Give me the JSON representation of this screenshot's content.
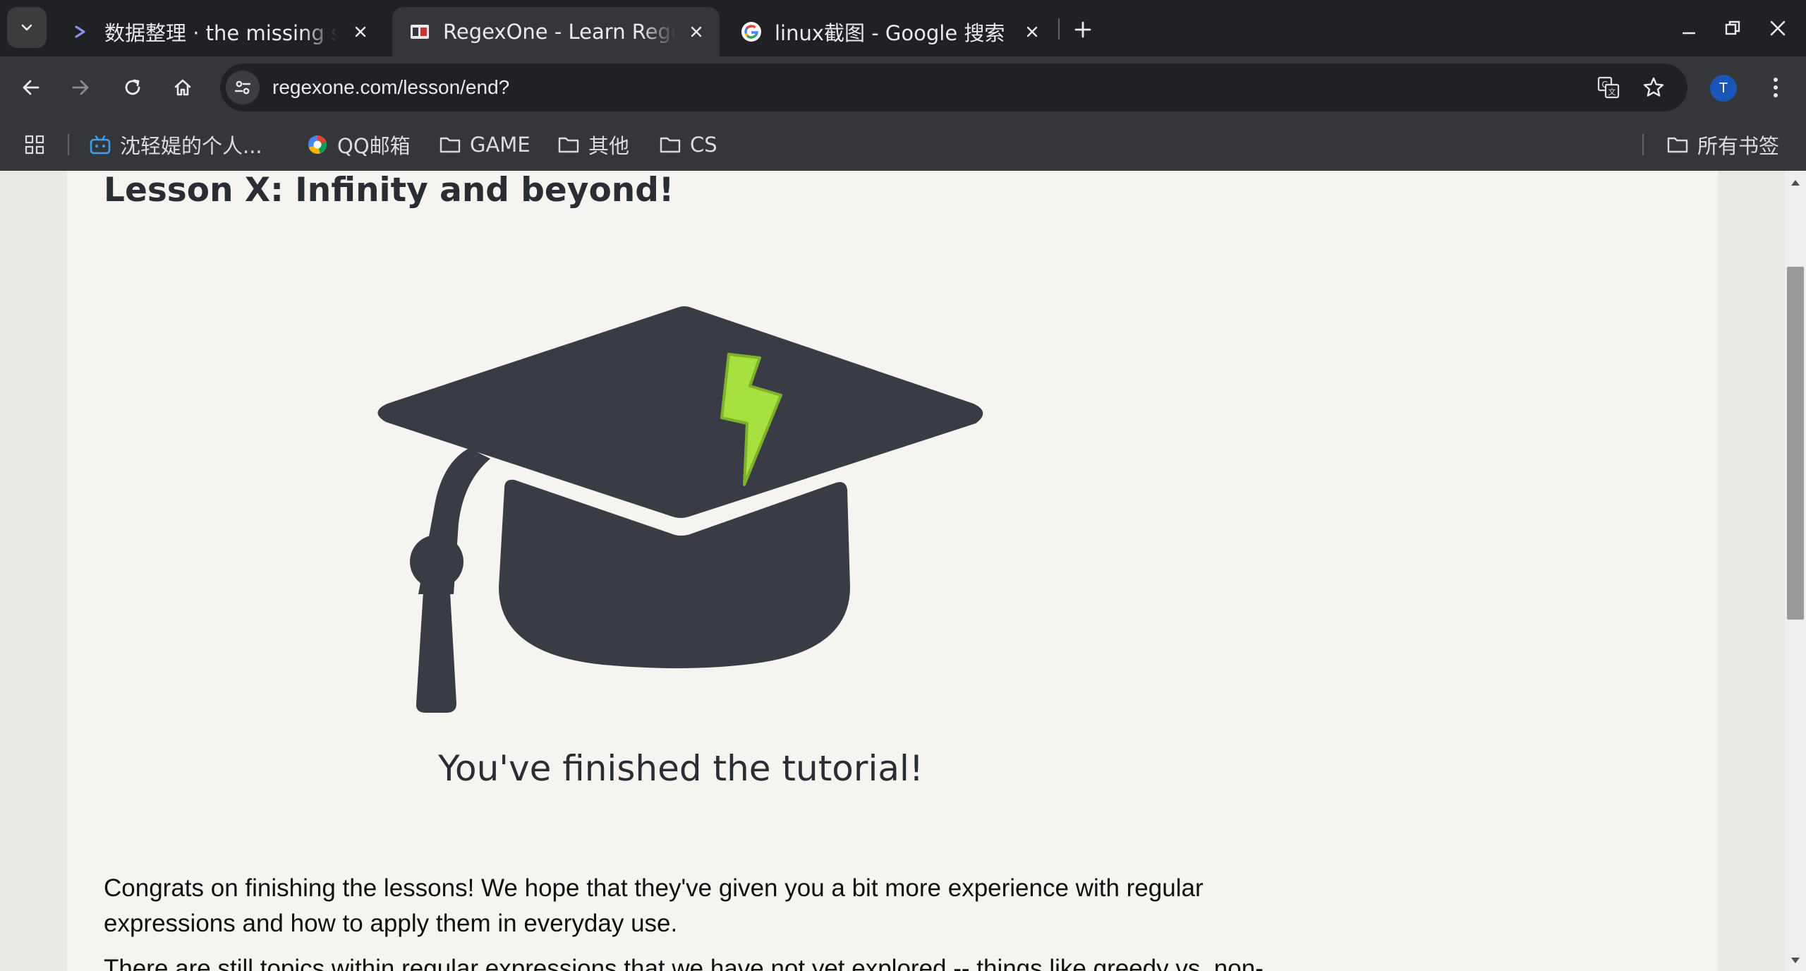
{
  "browser": {
    "tabs": [
      {
        "title": "数据整理 · the missing semester",
        "favicon": "chevron-prompt-icon",
        "active": false
      },
      {
        "title": "RegexOne - Learn Regular Expressions",
        "favicon": "regexone-icon",
        "active": true
      },
      {
        "title": "linux截图 - Google 搜索",
        "favicon": "google-icon",
        "active": false
      }
    ],
    "new_tab_icon": "plus-icon",
    "address_bar": {
      "url": "regexone.com/lesson/end?"
    },
    "profile_initial": "T",
    "bookmarks": [
      {
        "label": "沈轻媞的个人...",
        "icon": "bilibili-tv-icon"
      },
      {
        "label": "QQ邮箱",
        "icon": "qq-mail-icon"
      },
      {
        "label": "GAME",
        "icon": "folder-icon"
      },
      {
        "label": "其他",
        "icon": "folder-icon"
      },
      {
        "label": "CS",
        "icon": "folder-icon"
      }
    ],
    "all_bookmarks": {
      "label": "所有书签",
      "icon": "folder-icon"
    }
  },
  "page": {
    "lesson_title": "Lesson X: Infinity and beyond!",
    "image": "graduation-cap-lightning",
    "finished_heading": "You've finished the tutorial!",
    "paragraphs": [
      "Congrats on finishing the lessons! We hope that they've given you a bit more experience with regular expressions and how to apply them in everyday use.",
      "There are still topics within regular expressions that we have not yet explored -- things like greedy vs. non-"
    ]
  },
  "colors": {
    "tabstrip": "#202124",
    "toolbar": "#35363a",
    "page_bg": "#e9e8e4",
    "card_bg": "#f5f4f1",
    "cap": "#3a3c45",
    "lightning": "#a6e13f"
  }
}
